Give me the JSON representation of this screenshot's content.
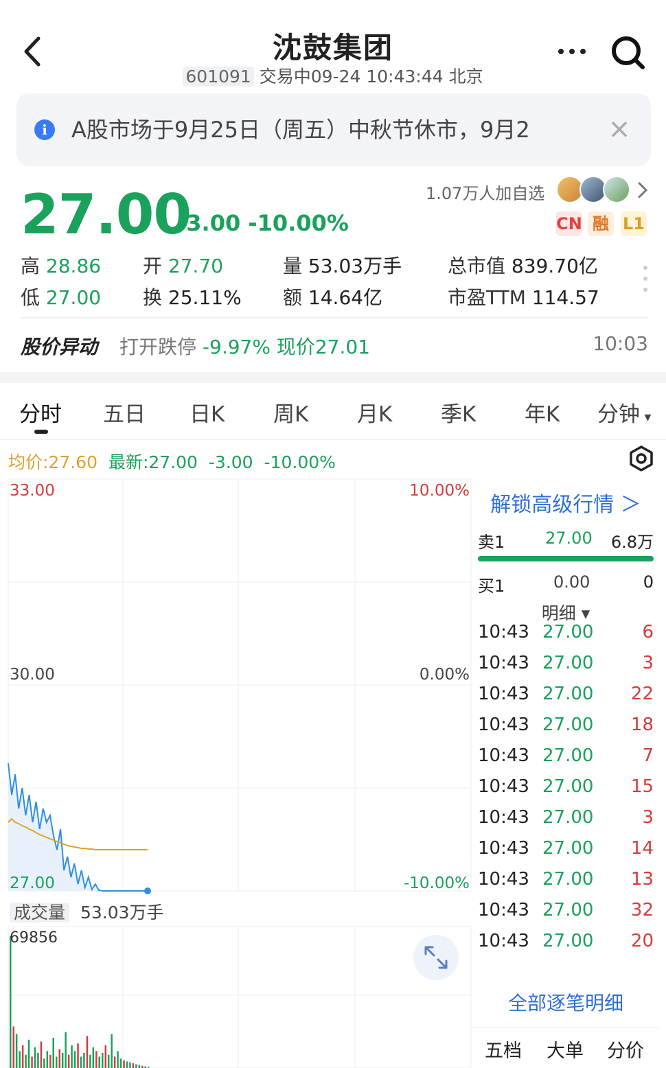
{
  "header": {
    "title": "沈鼓集团",
    "code": "601091",
    "status": "交易中09-24 10:43:44 北京"
  },
  "notice": {
    "text": "A股市场于9月25日（周五）中秋节休市，9月2",
    "close": "×"
  },
  "quote": {
    "price": "27.00",
    "change": "-3.00  -10.00%",
    "watchers": "1.07万人加自选",
    "tags": [
      "CN",
      "融",
      "L1"
    ]
  },
  "stats": {
    "high_label": "高",
    "high": "28.86",
    "low_label": "低",
    "low": "27.00",
    "open_label": "开",
    "open": "27.70",
    "turnover_label": "换",
    "turnover": "25.11%",
    "volume_label": "量",
    "volume": "53.03万手",
    "amount_label": "额",
    "amount": "14.64亿",
    "mktcap_label": "总市值",
    "mktcap": "839.70亿",
    "pe_label": "市盈TTM",
    "pe": "114.57"
  },
  "alert": {
    "label": "股价异动",
    "text": "打开跌停 ",
    "value": "-9.97% 现价27.01",
    "time": "10:03"
  },
  "tabs": [
    "分时",
    "五日",
    "日K",
    "周K",
    "月K",
    "季K",
    "年K",
    "分钟"
  ],
  "intraday_header": {
    "avg": "均价:27.60",
    "latest": "最新:27.00",
    "change": "-3.00",
    "pct": "-10.00%"
  },
  "chart_data": {
    "type": "line",
    "y_left_ticks": [
      "33.00",
      "30.00",
      "27.00"
    ],
    "y_right_ticks": [
      "10.00%",
      "0.00%",
      "-10.00%"
    ],
    "ylim": [
      27.0,
      33.0
    ],
    "series": [
      {
        "values": [
          28.86,
          28.4,
          28.7,
          28.2,
          28.5,
          28.1,
          28.4,
          28.0,
          28.3,
          27.9,
          28.2,
          28.0,
          28.1,
          27.8,
          27.6,
          27.9,
          27.3,
          27.5,
          27.2,
          27.4,
          27.1,
          27.3,
          27.05,
          27.2,
          27.02,
          27.1,
          27.01,
          27.0,
          27.0,
          27.0,
          27.0,
          27.0,
          27.0,
          27.0,
          27.0,
          27.0,
          27.0,
          27.0,
          27.0,
          27.0,
          27.0
        ]
      },
      {
        "values": [
          28.0,
          28.05,
          28.0,
          27.98,
          27.95,
          27.93,
          27.9,
          27.88,
          27.85,
          27.82,
          27.8,
          27.78,
          27.76,
          27.74,
          27.72,
          27.7,
          27.68,
          27.66,
          27.65,
          27.64,
          27.63,
          27.62,
          27.62,
          27.61,
          27.61,
          27.6,
          27.6,
          27.6,
          27.6,
          27.6,
          27.6,
          27.6,
          27.6,
          27.6,
          27.6,
          27.6,
          27.6,
          27.6,
          27.6,
          27.6,
          27.6
        ]
      }
    ],
    "volume_label": "成交量",
    "volume_total": "53.03万手",
    "volume_max": "69856",
    "volume": [
      69856,
      22000,
      18000,
      9000,
      12000,
      7000,
      15000,
      6000,
      11000,
      8000,
      14000,
      5000,
      9000,
      7000,
      16000,
      6000,
      10000,
      8000,
      19000,
      7000,
      12000,
      9000,
      13000,
      6000,
      8000,
      17000,
      7000,
      11000,
      9000,
      6000,
      8000,
      12000,
      7000,
      18000,
      6000,
      9000,
      5000,
      4000,
      3500,
      3000,
      2500,
      2000,
      1500,
      1200,
      900,
      700
    ]
  },
  "orderbook": {
    "unlock": "解锁高级行情 ＞",
    "sell1_label": "卖1",
    "sell1_price": "27.00",
    "sell1_vol": "6.8万",
    "buy1_label": "买1",
    "buy1_price": "0.00",
    "buy1_vol": "0",
    "detail": "明细 ▾",
    "trades": [
      {
        "time": "10:43",
        "price": "27.00",
        "vol": "6"
      },
      {
        "time": "10:43",
        "price": "27.00",
        "vol": "3"
      },
      {
        "time": "10:43",
        "price": "27.00",
        "vol": "22"
      },
      {
        "time": "10:43",
        "price": "27.00",
        "vol": "18"
      },
      {
        "time": "10:43",
        "price": "27.00",
        "vol": "7"
      },
      {
        "time": "10:43",
        "price": "27.00",
        "vol": "15"
      },
      {
        "time": "10:43",
        "price": "27.00",
        "vol": "3"
      },
      {
        "time": "10:43",
        "price": "27.00",
        "vol": "14"
      },
      {
        "time": "10:43",
        "price": "27.00",
        "vol": "13"
      },
      {
        "time": "10:43",
        "price": "27.00",
        "vol": "32"
      },
      {
        "time": "10:43",
        "price": "27.00",
        "vol": "20"
      }
    ],
    "all_trades": "全部逐笔明细",
    "bottom_tabs": [
      "五档",
      "大单",
      "分价"
    ]
  },
  "colors": {
    "down": "#1aa15c",
    "up": "#d63b3b",
    "avg_line": "#e0a030",
    "price_line": "#2f8ee0",
    "link": "#2f6fd8"
  }
}
